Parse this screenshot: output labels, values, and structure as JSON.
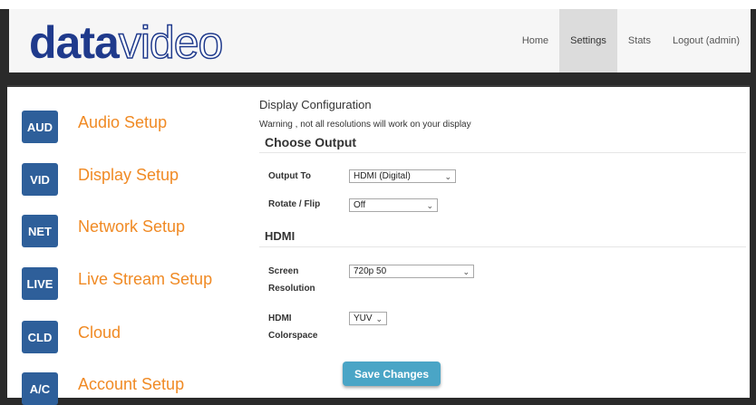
{
  "brand": {
    "part1": "data",
    "part2": "video"
  },
  "nav": {
    "items": [
      "Home",
      "Settings",
      "Stats",
      "Logout (admin)"
    ],
    "active_index": 1
  },
  "sidebar": {
    "items": [
      {
        "badge": "AUD",
        "label": "Audio Setup"
      },
      {
        "badge": "VID",
        "label": "Display Setup"
      },
      {
        "badge": "NET",
        "label": "Network Setup"
      },
      {
        "badge": "LIVE",
        "label": "Live Stream Setup"
      },
      {
        "badge": "CLD",
        "label": "Cloud"
      },
      {
        "badge": "A/C",
        "label": "Account Setup"
      }
    ]
  },
  "main": {
    "title": "Display Configuration",
    "warning": "Warning , not all resolutions will work on your display",
    "choose_output": "Choose Output",
    "hdmi_header": "HDMI",
    "output_to": {
      "label": "Output To",
      "value": "HDMI (Digital)"
    },
    "rotate_flip": {
      "label": "Rotate / Flip",
      "value": "Off"
    },
    "screen_resolution": {
      "label_line1": "Screen",
      "label_line2": "Resolution",
      "value": "720p 50"
    },
    "hdmi_colorspace": {
      "label_line1": "HDMI",
      "label_line2": "Colorspace",
      "value": "YUV"
    },
    "save_label": "Save Changes"
  },
  "colors": {
    "accent_orange": "#f08a24",
    "badge_blue": "#2e5f9a",
    "button_teal": "#4aa5c6",
    "logo_blue": "#1f3a8c"
  }
}
